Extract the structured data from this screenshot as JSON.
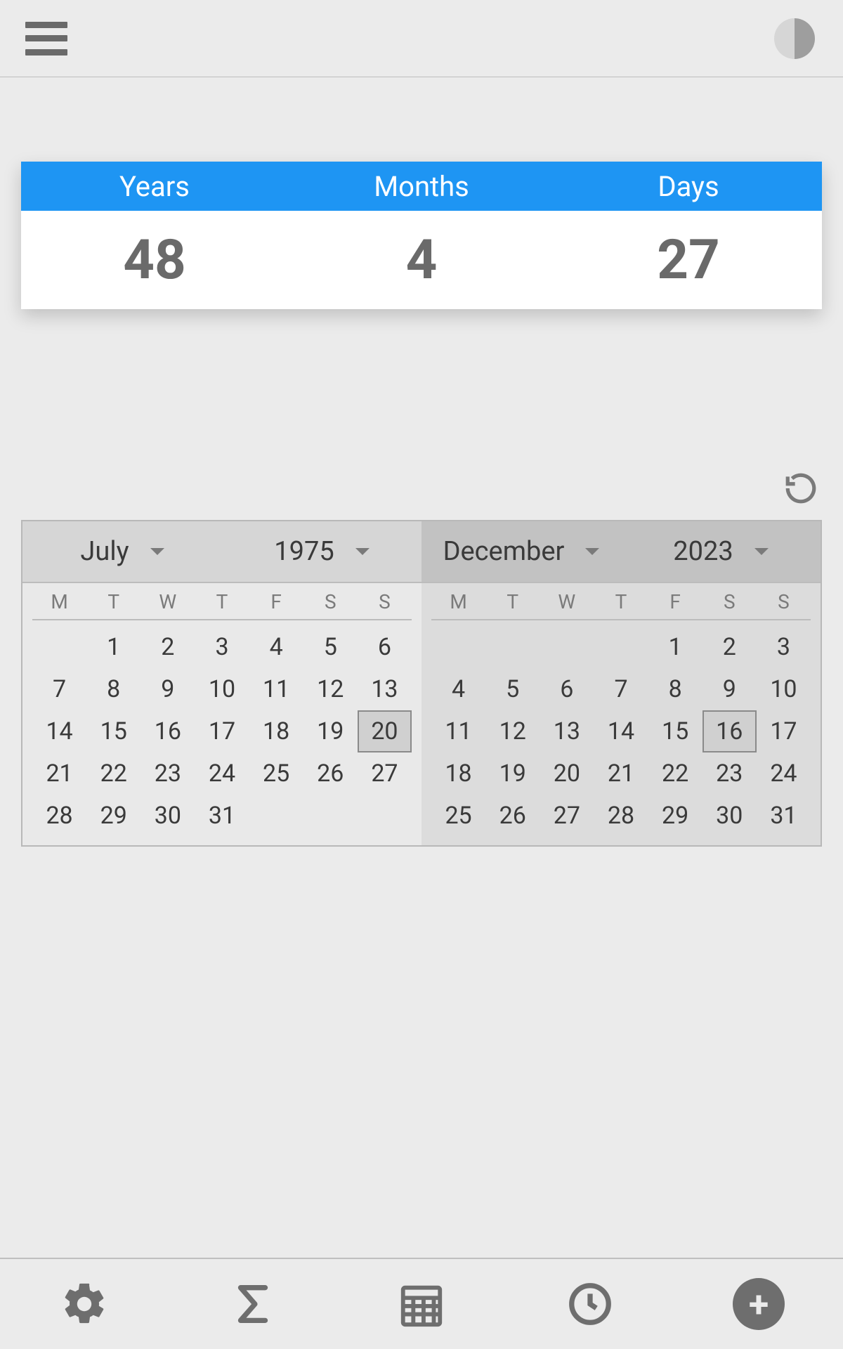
{
  "result": {
    "labels": {
      "years": "Years",
      "months": "Months",
      "days": "Days"
    },
    "values": {
      "years": "48",
      "months": "4",
      "days": "27"
    }
  },
  "dow": [
    "M",
    "T",
    "W",
    "T",
    "F",
    "S",
    "S"
  ],
  "calLeft": {
    "month": "July",
    "year": "1975",
    "leading_blanks": 1,
    "days_in_month": 31,
    "selected_day": 20
  },
  "calRight": {
    "month": "December",
    "year": "2023",
    "leading_blanks": 4,
    "days_in_month": 31,
    "selected_day": 16
  }
}
